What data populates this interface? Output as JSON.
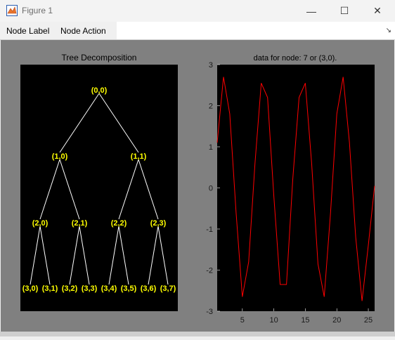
{
  "window": {
    "title": "Figure 1",
    "minimize": "—",
    "maximize": "☐",
    "close": "✕"
  },
  "menu": {
    "items": [
      "Node Label",
      "Node Action"
    ]
  },
  "tree_panel": {
    "title": "Tree Decomposition",
    "nodes": [
      "(0,0)",
      "(1,0)",
      "(1,1)",
      "(2,0)",
      "(2,1)",
      "(2,2)",
      "(2,3)",
      "(3,0)",
      "(3,1)",
      "(3,2)",
      "(3,3)",
      "(3,4)",
      "(3,5)",
      "(3,6)",
      "(3,7)"
    ],
    "node_color": "#ffff00",
    "edge_color": "#ffffff"
  },
  "chart_data": {
    "type": "line",
    "title": "data for node: 7 or (3,0).",
    "xlim": [
      1,
      26
    ],
    "ylim": [
      -3,
      3
    ],
    "xticks": [
      5,
      10,
      15,
      20,
      25
    ],
    "yticks": [
      3,
      2,
      1,
      0,
      -1,
      -2,
      -3
    ],
    "series": [
      {
        "color": "#ff0000",
        "x": [
          1,
          2,
          3,
          4,
          5,
          6,
          7,
          8,
          9,
          10,
          11,
          12,
          13,
          14,
          15,
          16,
          17,
          18,
          19,
          20,
          21,
          22,
          23,
          24,
          25,
          26
        ],
        "y": [
          1.1,
          2.7,
          1.8,
          -0.6,
          -2.65,
          -1.8,
          0.6,
          2.55,
          2.2,
          -0.2,
          -2.35,
          -2.35,
          0.2,
          2.2,
          2.55,
          0.6,
          -1.85,
          -2.65,
          -0.6,
          1.8,
          2.7,
          1.1,
          -1.2,
          -2.75,
          -1.4,
          0.05
        ]
      }
    ],
    "background": "#000000",
    "grid": false
  }
}
